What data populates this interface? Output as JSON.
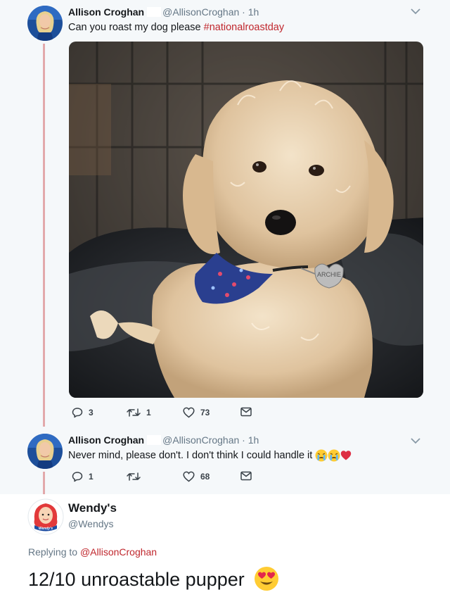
{
  "tweet1": {
    "name": "Allison Croghan",
    "handle": "@AllisonCroghan",
    "time": " · 1h",
    "text": "Can you roast my dog please ",
    "hashtag": "#nationalroastday",
    "photo_tag_text": "ARCHIE",
    "actions": {
      "replies": "3",
      "retweets": "1",
      "likes": "73"
    }
  },
  "tweet2": {
    "name": "Allison Croghan",
    "handle": "@AllisonCroghan",
    "time": " · 1h",
    "text": "Never mind, please don't. I don't think I could handle it",
    "actions": {
      "replies": "1",
      "retweets": "",
      "likes": "68"
    }
  },
  "main_tweet": {
    "name": "Wendy's",
    "handle": "@Wendys",
    "replying_prefix": "Replying to ",
    "replying_to": "@AllisonCroghan",
    "text": "12/10 unroastable pupper",
    "avatar_text": "Wendy's"
  },
  "colors": {
    "hashtag": "#c0272d",
    "thread_line": "#e2a9ab",
    "reply_bg": "#f5f8fa",
    "muted": "#657786"
  },
  "icons": [
    "chevron-down-icon",
    "reply-icon",
    "retweet-icon",
    "like-icon",
    "message-icon",
    "crying-emoji-icon",
    "heart-emoji-icon",
    "heart-eyes-emoji-icon"
  ]
}
